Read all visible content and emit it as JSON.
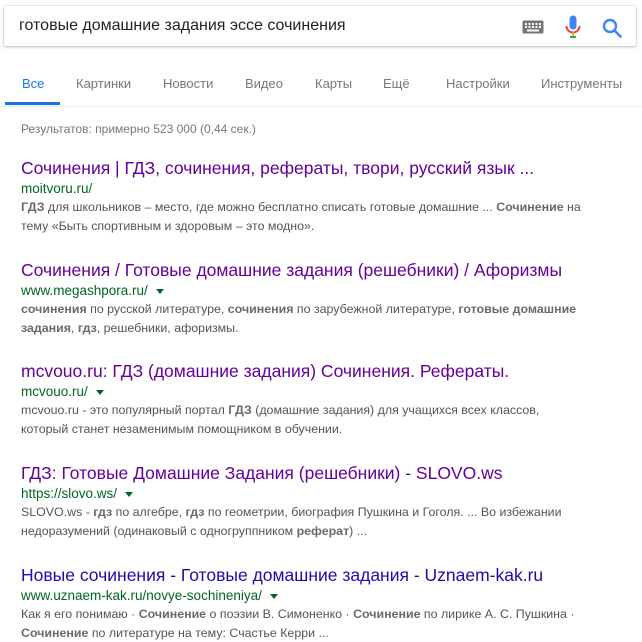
{
  "search": {
    "query": "готовые домашние задания эссе сочинения"
  },
  "icons": {
    "keyboard": "keyboard-icon",
    "microphone": "microphone-icon",
    "search": "search-icon"
  },
  "colors": {
    "accent": "#1a73e8",
    "link": "#1a0dab",
    "visited": "#660099",
    "url": "#006621",
    "snippet": "#545454"
  },
  "tabs": [
    {
      "label": "Все",
      "active": true
    },
    {
      "label": "Картинки"
    },
    {
      "label": "Новости"
    },
    {
      "label": "Видео"
    },
    {
      "label": "Карты"
    },
    {
      "label": "Ещё"
    },
    {
      "label": "Настройки"
    },
    {
      "label": "Инструменты"
    }
  ],
  "stats": "Результатов: примерно 523 000 (0,44 сек.)",
  "results": [
    {
      "title": "Сочинения | ГДЗ, сочинения, рефераты, твори, русский язык ...",
      "url": "moitvoru.ru/",
      "has_caret": false,
      "visited": true,
      "snippet": [
        [
          {
            "t": "ГДЗ",
            "b": true
          },
          {
            "t": " для школьников – место, где можно бесплатно списать готовые домашние ... "
          },
          {
            "t": "Сочинение",
            "b": true
          },
          {
            "t": " на"
          }
        ],
        [
          {
            "t": "тему «Быть спортивным и здоровым – это модно»."
          }
        ]
      ]
    },
    {
      "title": "Сочинения / Готовые домашние задания (решебники) / Афоризмы",
      "url": "www.megashpora.ru/",
      "has_caret": true,
      "visited": true,
      "snippet": [
        [
          {
            "t": "сочинения",
            "b": true
          },
          {
            "t": " по русской литературе, "
          },
          {
            "t": "сочинения",
            "b": true
          },
          {
            "t": " по зарубежной литературе, "
          },
          {
            "t": "готовые домашние",
            "b": true
          }
        ],
        [
          {
            "t": "задания",
            "b": true
          },
          {
            "t": ", "
          },
          {
            "t": "гдз",
            "b": true
          },
          {
            "t": ", решебники, афоризмы."
          }
        ]
      ]
    },
    {
      "title": "mcvouo.ru: ГДЗ (домашние задания) Сочинения. Рефераты.",
      "url": "mcvouo.ru/",
      "has_caret": true,
      "visited": true,
      "snippet": [
        [
          {
            "t": "mcvouo.ru - это популярный портал "
          },
          {
            "t": "ГДЗ",
            "b": true
          },
          {
            "t": " (домашние задания) для учащихся всех классов,"
          }
        ],
        [
          {
            "t": "который станет незаменимым помощником в обучении."
          }
        ]
      ]
    },
    {
      "title": "ГДЗ: Готовые Домашние Задания (решебники) - SLOVO.ws",
      "url": "https://slovo.ws/",
      "has_caret": true,
      "visited": true,
      "snippet": [
        [
          {
            "t": "SLOVO.ws - "
          },
          {
            "t": "гдз",
            "b": true
          },
          {
            "t": " по алгебре, "
          },
          {
            "t": "гдз",
            "b": true
          },
          {
            "t": " по геометрии, биография Пушкина и Гоголя. ... Во избежании"
          }
        ],
        [
          {
            "t": "недоразумений (одинаковый с одногруппником "
          },
          {
            "t": "реферат",
            "b": true
          },
          {
            "t": ") ..."
          }
        ]
      ]
    },
    {
      "title": "Новые сочинения - Готовые домашние задания - Uznaem-kak.ru",
      "url": "www.uznaem-kak.ru/novye-sochineniya/",
      "has_caret": true,
      "visited": false,
      "snippet": [
        [
          {
            "t": "Как я его понимаю · "
          },
          {
            "t": "Сочинение",
            "b": true
          },
          {
            "t": " о поэзии В. Симоненко · "
          },
          {
            "t": "Сочинение",
            "b": true
          },
          {
            "t": " по лирике А. С. Пушкина ·"
          }
        ],
        [
          {
            "t": "Сочинение",
            "b": true
          },
          {
            "t": " по литературе на тему: Счастье Керри ..."
          }
        ]
      ]
    }
  ]
}
